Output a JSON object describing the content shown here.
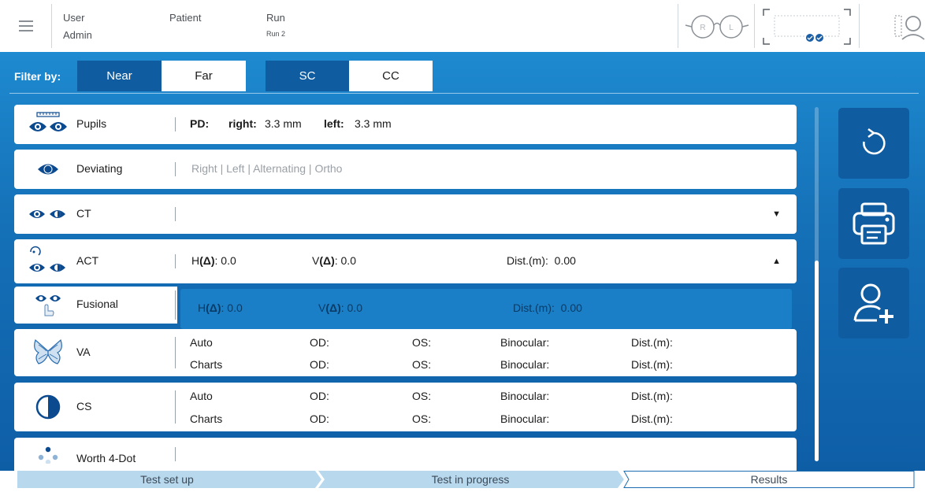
{
  "header": {
    "user_label": "User",
    "user_value": "Admin",
    "patient_label": "Patient",
    "patient_value": "",
    "run_label": "Run",
    "run_value": "Run 2",
    "glasses_right": "R",
    "glasses_left": "L"
  },
  "filter": {
    "label": "Filter by:",
    "near": "Near",
    "far": "Far",
    "sc": "SC",
    "cc": "CC"
  },
  "rows": {
    "pupils": {
      "name": "Pupils",
      "pd_label": "PD:",
      "right_label": "right:",
      "right_value": "3.3 mm",
      "left_label": "left:",
      "left_value": "3.3 mm"
    },
    "deviating": {
      "name": "Deviating",
      "options": "Right | Left | Alternating | Ortho"
    },
    "ct": {
      "name": "CT"
    },
    "act": {
      "name": "ACT",
      "h_label": "H",
      "h_symbol": "(Δ)",
      "h_value": ": 0.0",
      "v_label": "V",
      "v_symbol": "(Δ)",
      "v_value": ": 0.0",
      "dist_label": "Dist.(m):",
      "dist_value": "0.00"
    },
    "fusional": {
      "name": "Fusional",
      "h_label": "H",
      "h_symbol": "(Δ)",
      "h_value": ": 0.0",
      "v_label": "V",
      "v_symbol": "(Δ)",
      "v_value": ": 0.0",
      "dist_label": "Dist.(m):",
      "dist_value": "0.00"
    },
    "va": {
      "name": "VA",
      "auto": "Auto",
      "charts": "Charts",
      "od": "OD:",
      "os": "OS:",
      "binocular": "Binocular:",
      "dist": "Dist.(m):"
    },
    "cs": {
      "name": "CS",
      "auto": "Auto",
      "charts": "Charts",
      "od": "OD:",
      "os": "OS:",
      "binocular": "Binocular:",
      "dist": "Dist.(m):"
    },
    "worth": {
      "name": "Worth 4-Dot"
    }
  },
  "progress": {
    "step1": "Test set up",
    "step2": "Test in progress",
    "step3": "Results"
  },
  "colors": {
    "brand_blue": "#1a7fc6",
    "dark_blue": "#0f5ca0",
    "icon_blue": "#0c4a8f"
  }
}
